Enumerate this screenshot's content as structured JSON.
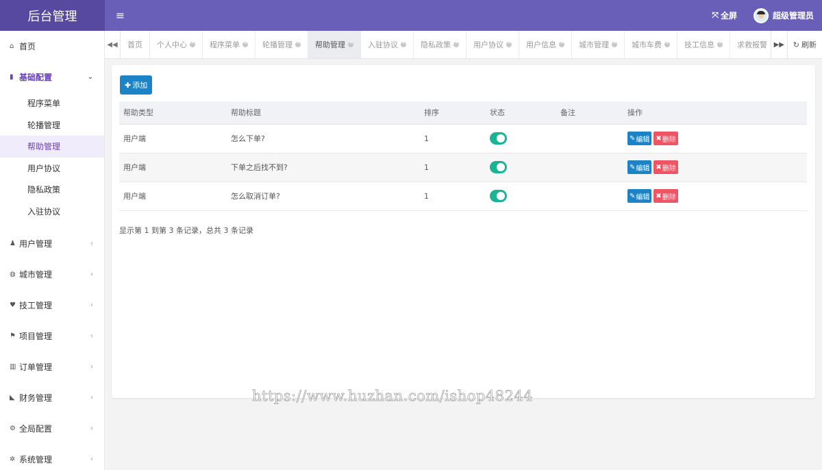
{
  "app": {
    "title": "后台管理"
  },
  "header": {
    "menu_icon": "hamburger-icon",
    "fullscreen_label": "全屏",
    "user_name": "超级管理员"
  },
  "sidebar": {
    "home": "首页",
    "basic_config": "基础配置",
    "sub_items": [
      "程序菜单",
      "轮播管理",
      "帮助管理",
      "用户协议",
      "隐私政策",
      "入驻协议"
    ],
    "groups": [
      "用户管理",
      "城市管理",
      "技工管理",
      "项目管理",
      "订单管理",
      "财务管理",
      "全局配置",
      "系统管理"
    ]
  },
  "tabs": {
    "items": [
      "首页",
      "个人中心",
      "程序菜单",
      "轮播管理",
      "帮助管理",
      "入驻协议",
      "隐私政策",
      "用户协议",
      "用户信息",
      "城市管理",
      "城市车费",
      "技工信息",
      "求救报警"
    ],
    "refresh_label": "刷新"
  },
  "content": {
    "add_label": "添加",
    "columns": [
      "帮助类型",
      "帮助标题",
      "排序",
      "状态",
      "备注",
      "操作"
    ],
    "rows": [
      {
        "type": "用户端",
        "title": "怎么下单?",
        "sort": "1",
        "remark": ""
      },
      {
        "type": "用户端",
        "title": "下单之后找不到?",
        "sort": "1",
        "remark": ""
      },
      {
        "type": "用户端",
        "title": "怎么取消订单?",
        "sort": "1",
        "remark": ""
      }
    ],
    "edit_label": "编辑",
    "delete_label": "删除",
    "pagination_text": "显示第 1 到第 3 条记录，总共 3 条记录"
  },
  "watermark": "https://www.huzhan.com/ishop48244",
  "colors": {
    "header": "#6a5fb8",
    "brand": "#56499f",
    "primary": "#1c84c6",
    "danger": "#ed5565",
    "toggle_on": "#1ab394",
    "accent": "#6a3fc2"
  }
}
